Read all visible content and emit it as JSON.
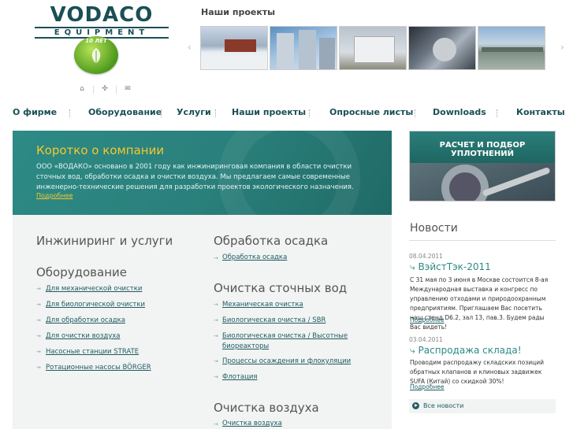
{
  "header": {
    "logo_word": "VODACO",
    "logo_sub": "EQUIPMENT",
    "badge_text": "10 ЛЕТ",
    "icons": [
      "home-icon",
      "sitemap-icon",
      "mail-icon"
    ]
  },
  "projects": {
    "title": "Наши проекты",
    "prev_icon": "chevron-left-icon",
    "next_icon": "chevron-right-icon"
  },
  "nav": {
    "items": [
      "О фирме",
      "Оборудование",
      "Услуги",
      "Наши проекты",
      "Опросные листы",
      "Downloads",
      "Контакты"
    ]
  },
  "hero": {
    "title": "Коротко о компании",
    "text": "ООО «ВОДАКО» основано в 2001 году как инжиниринговая компания в области очистки сточных вод, обработки осадка и очистки воздуха. Мы предлагаем самые современные инженерно-технические решения для разработки проектов экологического назначения.",
    "more": "Подробнее"
  },
  "left_col": {
    "engineering_heading": "Инжиниринг и услуги",
    "equipment_heading": "Оборудование",
    "equipment_links": [
      "Для механической очистки",
      "Для биологической очистки",
      "Для обработки осадка",
      "Для очистки воздуха",
      "Насосные станции STRATE",
      "Ротационные насосы BÖRGER"
    ]
  },
  "right_col": {
    "sludge_heading": "Обработка осадка",
    "sludge_links": [
      "Обработка осадка"
    ],
    "wastewater_heading": "Очистка сточных вод",
    "wastewater_links": [
      "Механическая очистка",
      "Биологическая очистка / SBR",
      "Биологическая очистка / Высотные биореакторы",
      "Процессы осаждения и флокуляции",
      "Флотация"
    ],
    "air_heading": "Очистка воздуха",
    "air_links": [
      "Очистка воздуха"
    ]
  },
  "promo": {
    "text": "РАСЧЕТ И ПОДБОР УПЛОТНЕНИЙ"
  },
  "news": {
    "title": "Новости",
    "items": [
      {
        "date": "08.04.2011",
        "title": "ВэйстТэк-2011",
        "text": "С 31 мая по 3 июня в Москве состоится 8-ая Международная выставка и конгресс по управлению отходами и природоохранным предприятиям. Приглашаем Вас посетить наш стенд D6.2, зал 13, пав.3. Будем рады Вас видеть!",
        "more": "Подробнее"
      },
      {
        "date": "03.04.2011",
        "title": "Распродажа склада!",
        "text": "Проводим распродажу складских позиций обратных клапанов и клиновых задвижек SUFA (Китай) со скидкой 30%!",
        "more": "Подробнее"
      }
    ],
    "all_news": "Все новости"
  },
  "colors": {
    "teal": "#2a7f7b",
    "yellow": "#f4c92d",
    "link": "#1e5c62",
    "content_bg": "#f2f3f3"
  }
}
